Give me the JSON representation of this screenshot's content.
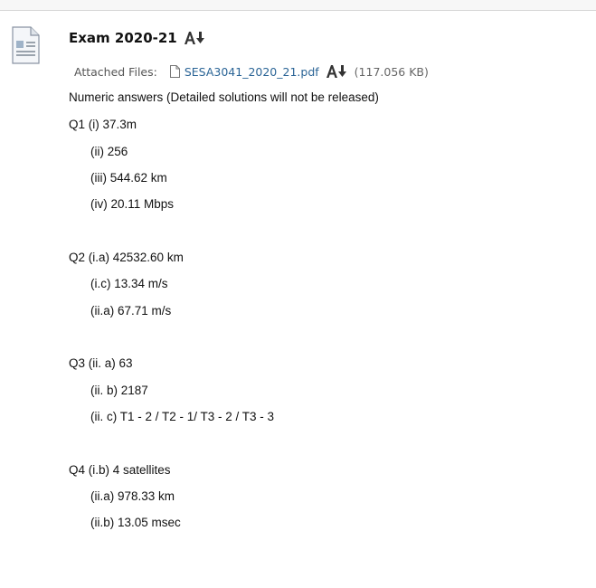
{
  "item": {
    "title": "Exam 2020-21",
    "title_icon": "az-reader-icon",
    "doc_icon": "document-icon"
  },
  "attachment": {
    "label": "Attached Files:",
    "file_icon": "file-icon",
    "filename": "SESA3041_2020_21.pdf",
    "download_icon": "az-reader-icon",
    "size": "(117.056 KB)"
  },
  "body": {
    "intro": "Numeric answers (Detailed solutions will not be released)",
    "lines": [
      "Q1 (i) 37.3m",
      "(ii) 256",
      "(iii) 544.62 km",
      "(iv) 20.11 Mbps",
      "Q2 (i.a) 42532.60 km",
      "(i.c) 13.34 m/s",
      "(ii.a) 67.71 m/s",
      "Q3 (ii. a) 63",
      "(ii. b) 2187",
      "(ii. c) T1 - 2 / T2 - 1/ T3 - 2 / T3 - 3",
      "Q4 (i.b) 4 satellites",
      "(ii.a) 978.33 km",
      "(ii.b) 13.05 msec"
    ]
  }
}
